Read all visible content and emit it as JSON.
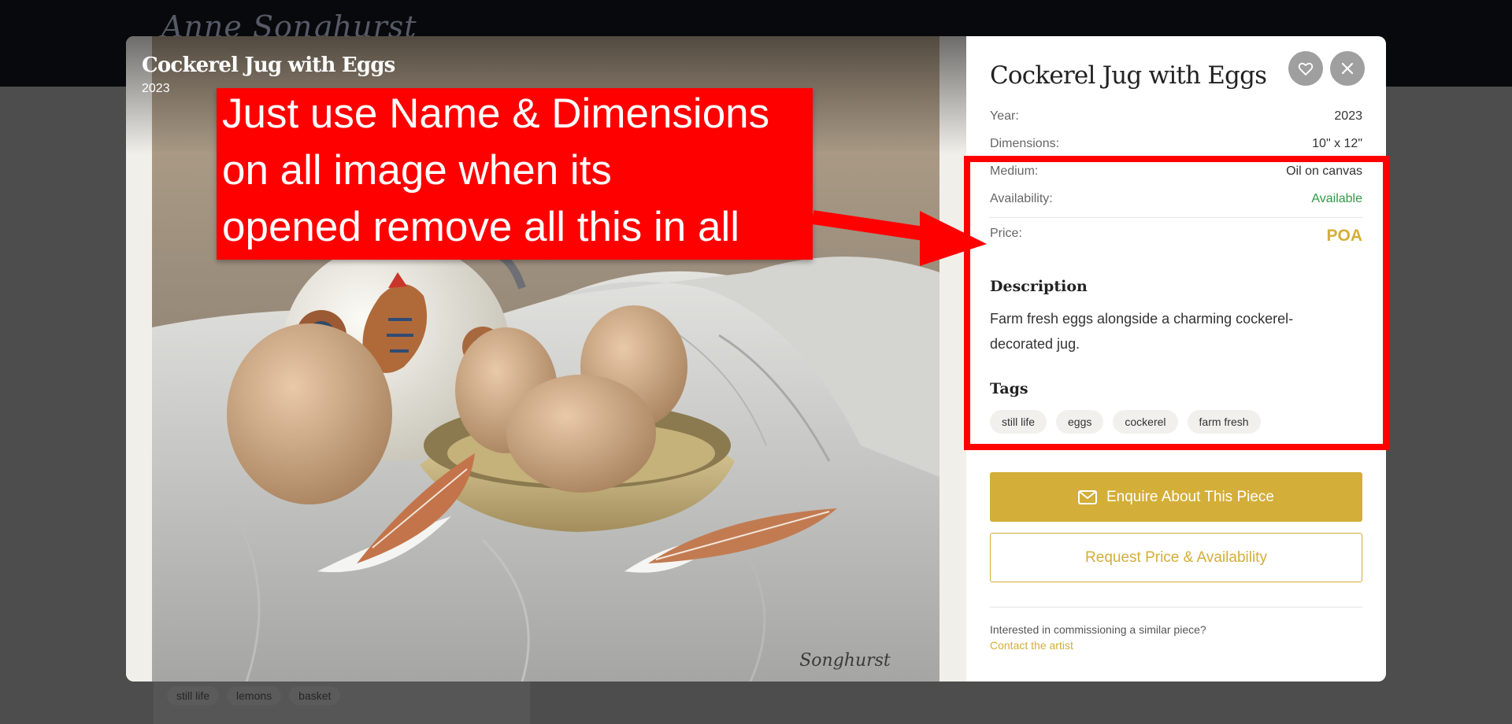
{
  "site": {
    "title": "Anne Songhurst"
  },
  "background": {
    "tags": [
      "still life",
      "lemons",
      "basket"
    ]
  },
  "image_overlay": {
    "title": "Cockerel Jug with Eggs",
    "year": "2023"
  },
  "artwork": {
    "title": "Cockerel Jug with Eggs",
    "details": [
      {
        "key": "Year:",
        "value": "2023"
      },
      {
        "key": "Dimensions:",
        "value": "10\" x 12\""
      },
      {
        "key": "Medium:",
        "value": "Oil on canvas"
      },
      {
        "key": "Availability:",
        "value": "Available"
      }
    ],
    "price_label": "Price:",
    "price_value": "POA",
    "description_heading": "Description",
    "description": "Farm fresh eggs alongside a charming cockerel-decorated jug.",
    "tags_heading": "Tags",
    "tags": [
      "still life",
      "eggs",
      "cockerel",
      "farm fresh"
    ],
    "enquire_label": "Enquire About This Piece",
    "request_label": "Request Price & Availability",
    "commission_text": "Interested in commissioning a similar piece?",
    "contact_label": "Contact the artist",
    "signature": "Songhurst"
  },
  "annotation": {
    "lines": [
      "Just use Name & Dimensions",
      "on all image when its",
      "opened remove all this in all"
    ]
  },
  "colors": {
    "accent": "#d3ae38",
    "available": "#2e9b45",
    "annotation": "#ff0000"
  },
  "icons": [
    "heart-icon",
    "close-icon",
    "mail-icon"
  ]
}
